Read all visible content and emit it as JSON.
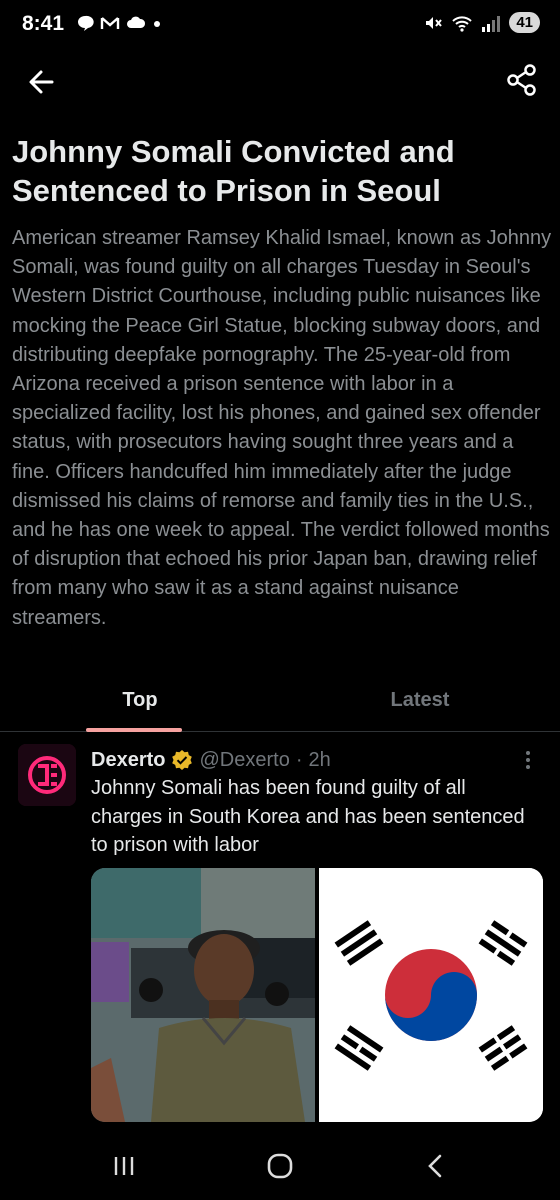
{
  "status_bar": {
    "time": "8:41",
    "battery": "41",
    "left_icons": [
      "chat-icon",
      "gmail-icon",
      "cloud-icon",
      "dot-icon"
    ],
    "right_icons": [
      "mute-icon",
      "wifi-icon",
      "signal-icon"
    ]
  },
  "nav": {
    "back_icon": "arrow-left-icon",
    "share_icon": "share-icon"
  },
  "article": {
    "title": "Johnny Somali Convicted and Sentenced to Prison in Seoul",
    "summary": "American streamer Ramsey Khalid Ismael, known as Johnny Somali, was found guilty on all charges Tuesday in Seoul's Western District Courthouse, including public nuisances like mocking the Peace Girl Statue, blocking subway doors, and distributing deepfake pornography. The 25-year-old from Arizona received a prison sentence with labor in a specialized facility, lost his phones, and gained sex offender status, with prosecutors having sought three years and a fine. Officers handcuffed him immediately after the judge dismissed his claims of remorse and family ties in the U.S., and he has one week to appeal. The verdict followed months of disruption that echoed his prior Japan ban, drawing relief from many who saw it as a stand against nuisance streamers."
  },
  "tabs": [
    {
      "label": "Top",
      "active": true
    },
    {
      "label": "Latest",
      "active": false
    }
  ],
  "tweet": {
    "author_name": "Dexerto",
    "verified_color": "#e8b829",
    "handle": "@Dexerto",
    "separator": "·",
    "time": "2h",
    "text": "Johnny Somali has been found guilty of all charges in South Korea and has been sentenced to prison with labor",
    "media": [
      "photo-of-man",
      "south-korea-flag"
    ]
  },
  "system_nav": {
    "icons": [
      "recent-apps-icon",
      "home-icon",
      "back-icon"
    ]
  },
  "colors": {
    "accent": "#f6a2a0",
    "muted_text": "#8b8f93"
  }
}
